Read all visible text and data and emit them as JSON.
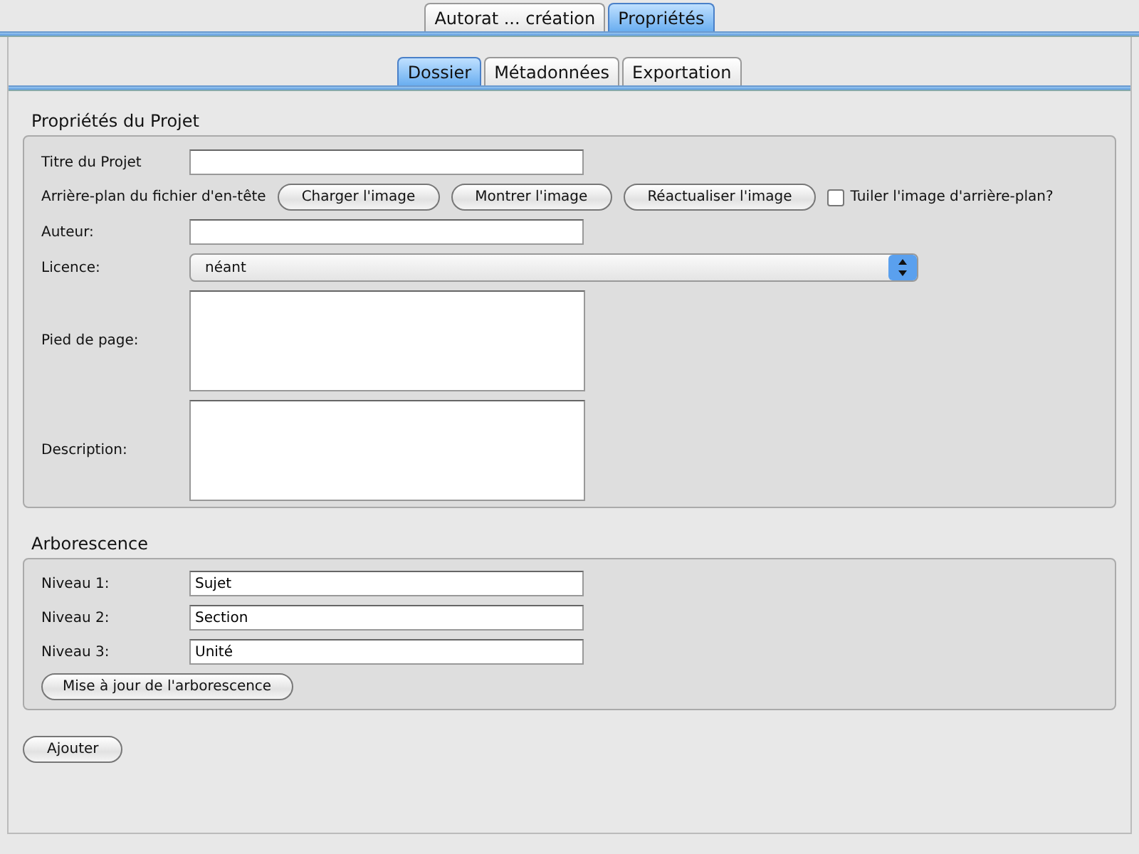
{
  "top_tabs": [
    {
      "label": "Autorat ... création",
      "selected": false
    },
    {
      "label": "Propriétés",
      "selected": true
    }
  ],
  "sub_tabs": [
    {
      "label": "Dossier",
      "selected": true
    },
    {
      "label": "Métadonnées",
      "selected": false
    },
    {
      "label": "Exportation",
      "selected": false
    }
  ],
  "project": {
    "title": "Propriétés du Projet",
    "title_label": "Titre du Projet",
    "background_label": "Arrière-plan du fichier d'en-tête",
    "background_buttons": [
      "Charger l'image",
      "Montrer l'image",
      "Réactualiser l'image"
    ],
    "tile_checkbox": {
      "label": "Tuiler l'image d'arrière-plan?",
      "checked": false
    },
    "author_label": "Auteur:",
    "license_label": "Licence:",
    "license_value": "néant",
    "footer_label": "Pied de page:",
    "description_label": "Description:"
  },
  "tree": {
    "title": "Arborescence",
    "levels": [
      {
        "label": "Niveau 1:",
        "value": "Sujet"
      },
      {
        "label": "Niveau 2:",
        "value": "Section"
      },
      {
        "label": "Niveau 3:",
        "value": "Unité"
      }
    ],
    "update_button": "Mise à jour de l'arborescence"
  },
  "add_button": "Ajouter"
}
